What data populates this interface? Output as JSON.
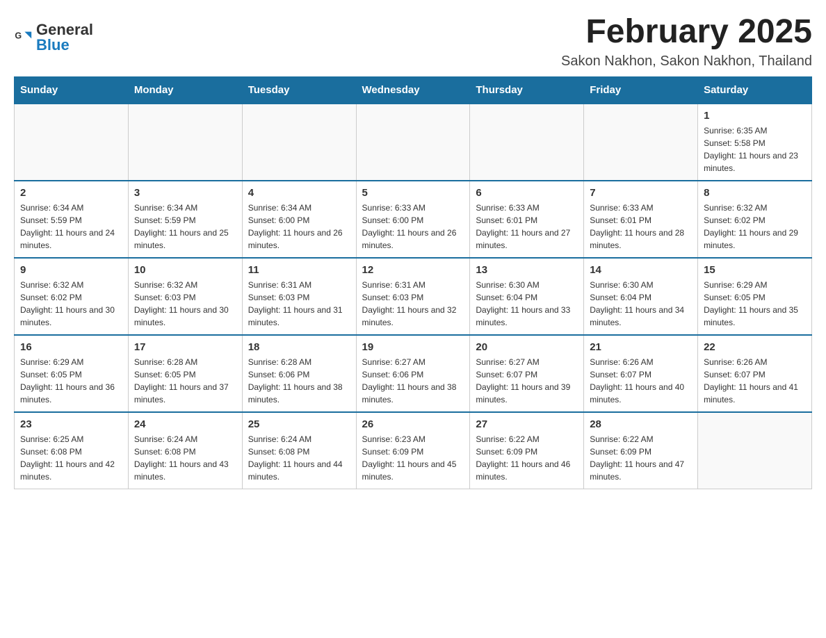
{
  "header": {
    "logo": {
      "text_general": "General",
      "text_blue": "Blue"
    },
    "title": "February 2025",
    "subtitle": "Sakon Nakhon, Sakon Nakhon, Thailand"
  },
  "weekdays": [
    "Sunday",
    "Monday",
    "Tuesday",
    "Wednesday",
    "Thursday",
    "Friday",
    "Saturday"
  ],
  "weeks": [
    [
      {
        "day": "",
        "info": ""
      },
      {
        "day": "",
        "info": ""
      },
      {
        "day": "",
        "info": ""
      },
      {
        "day": "",
        "info": ""
      },
      {
        "day": "",
        "info": ""
      },
      {
        "day": "",
        "info": ""
      },
      {
        "day": "1",
        "info": "Sunrise: 6:35 AM\nSunset: 5:58 PM\nDaylight: 11 hours and 23 minutes."
      }
    ],
    [
      {
        "day": "2",
        "info": "Sunrise: 6:34 AM\nSunset: 5:59 PM\nDaylight: 11 hours and 24 minutes."
      },
      {
        "day": "3",
        "info": "Sunrise: 6:34 AM\nSunset: 5:59 PM\nDaylight: 11 hours and 25 minutes."
      },
      {
        "day": "4",
        "info": "Sunrise: 6:34 AM\nSunset: 6:00 PM\nDaylight: 11 hours and 26 minutes."
      },
      {
        "day": "5",
        "info": "Sunrise: 6:33 AM\nSunset: 6:00 PM\nDaylight: 11 hours and 26 minutes."
      },
      {
        "day": "6",
        "info": "Sunrise: 6:33 AM\nSunset: 6:01 PM\nDaylight: 11 hours and 27 minutes."
      },
      {
        "day": "7",
        "info": "Sunrise: 6:33 AM\nSunset: 6:01 PM\nDaylight: 11 hours and 28 minutes."
      },
      {
        "day": "8",
        "info": "Sunrise: 6:32 AM\nSunset: 6:02 PM\nDaylight: 11 hours and 29 minutes."
      }
    ],
    [
      {
        "day": "9",
        "info": "Sunrise: 6:32 AM\nSunset: 6:02 PM\nDaylight: 11 hours and 30 minutes."
      },
      {
        "day": "10",
        "info": "Sunrise: 6:32 AM\nSunset: 6:03 PM\nDaylight: 11 hours and 30 minutes."
      },
      {
        "day": "11",
        "info": "Sunrise: 6:31 AM\nSunset: 6:03 PM\nDaylight: 11 hours and 31 minutes."
      },
      {
        "day": "12",
        "info": "Sunrise: 6:31 AM\nSunset: 6:03 PM\nDaylight: 11 hours and 32 minutes."
      },
      {
        "day": "13",
        "info": "Sunrise: 6:30 AM\nSunset: 6:04 PM\nDaylight: 11 hours and 33 minutes."
      },
      {
        "day": "14",
        "info": "Sunrise: 6:30 AM\nSunset: 6:04 PM\nDaylight: 11 hours and 34 minutes."
      },
      {
        "day": "15",
        "info": "Sunrise: 6:29 AM\nSunset: 6:05 PM\nDaylight: 11 hours and 35 minutes."
      }
    ],
    [
      {
        "day": "16",
        "info": "Sunrise: 6:29 AM\nSunset: 6:05 PM\nDaylight: 11 hours and 36 minutes."
      },
      {
        "day": "17",
        "info": "Sunrise: 6:28 AM\nSunset: 6:05 PM\nDaylight: 11 hours and 37 minutes."
      },
      {
        "day": "18",
        "info": "Sunrise: 6:28 AM\nSunset: 6:06 PM\nDaylight: 11 hours and 38 minutes."
      },
      {
        "day": "19",
        "info": "Sunrise: 6:27 AM\nSunset: 6:06 PM\nDaylight: 11 hours and 38 minutes."
      },
      {
        "day": "20",
        "info": "Sunrise: 6:27 AM\nSunset: 6:07 PM\nDaylight: 11 hours and 39 minutes."
      },
      {
        "day": "21",
        "info": "Sunrise: 6:26 AM\nSunset: 6:07 PM\nDaylight: 11 hours and 40 minutes."
      },
      {
        "day": "22",
        "info": "Sunrise: 6:26 AM\nSunset: 6:07 PM\nDaylight: 11 hours and 41 minutes."
      }
    ],
    [
      {
        "day": "23",
        "info": "Sunrise: 6:25 AM\nSunset: 6:08 PM\nDaylight: 11 hours and 42 minutes."
      },
      {
        "day": "24",
        "info": "Sunrise: 6:24 AM\nSunset: 6:08 PM\nDaylight: 11 hours and 43 minutes."
      },
      {
        "day": "25",
        "info": "Sunrise: 6:24 AM\nSunset: 6:08 PM\nDaylight: 11 hours and 44 minutes."
      },
      {
        "day": "26",
        "info": "Sunrise: 6:23 AM\nSunset: 6:09 PM\nDaylight: 11 hours and 45 minutes."
      },
      {
        "day": "27",
        "info": "Sunrise: 6:22 AM\nSunset: 6:09 PM\nDaylight: 11 hours and 46 minutes."
      },
      {
        "day": "28",
        "info": "Sunrise: 6:22 AM\nSunset: 6:09 PM\nDaylight: 11 hours and 47 minutes."
      },
      {
        "day": "",
        "info": ""
      }
    ]
  ]
}
